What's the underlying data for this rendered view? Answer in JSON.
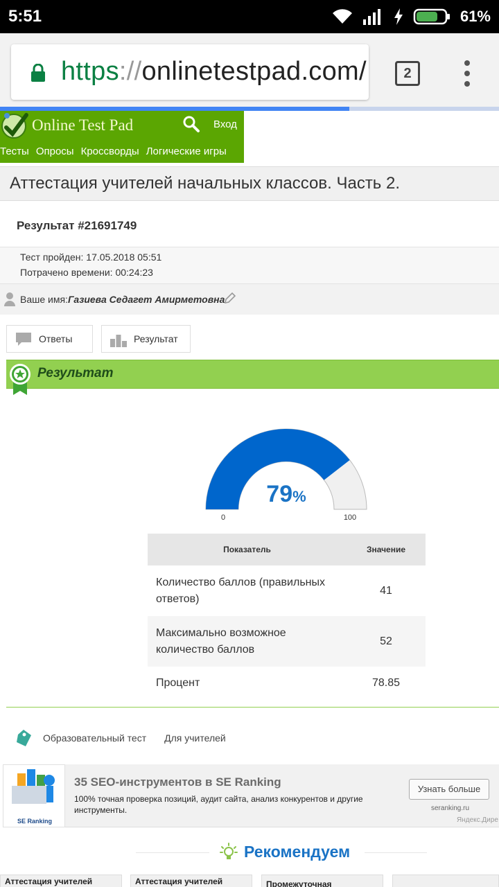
{
  "status_bar": {
    "time": "5:51",
    "battery_percent": "61%"
  },
  "browser": {
    "url": {
      "scheme": "https",
      "separator": "://",
      "host": "onlinetestpad.com/"
    },
    "tab_count": "2",
    "load_progress": 0.7
  },
  "site": {
    "name": "Online Test Pad",
    "login": "Вход",
    "nav": [
      "Тесты",
      "Опросы",
      "Кроссворды",
      "Логические игры"
    ]
  },
  "page": {
    "title": "Аттестация учителей начальных классов. Часть 2.",
    "result_id": "Результат #21691749"
  },
  "meta": {
    "passed_label": "Тест пройден:",
    "passed_value": "17.05.2018 05:51",
    "time_label": "Потрачено времени:",
    "time_value": "00:24:23"
  },
  "user": {
    "label": "Ваше имя:",
    "name": "Газиева Седагет Амирметовна"
  },
  "tabs": {
    "answers": "Ответы",
    "result": "Результат"
  },
  "result_section": {
    "title": "Результат"
  },
  "gauge": {
    "value": 79,
    "unit": "%",
    "min_label": "0",
    "max_label": "100",
    "color": "#0066cc"
  },
  "score_table": {
    "headers": [
      "Показатель",
      "Значение"
    ],
    "rows": [
      {
        "label": "Количество баллов (правильных ответов)",
        "value": "41"
      },
      {
        "label": "Максимально возможное количество баллов",
        "value": "52"
      },
      {
        "label": "Процент",
        "value": "78.85"
      }
    ]
  },
  "tags": [
    "Образовательный тест",
    "Для учителей"
  ],
  "ad": {
    "logo_text": "SE Ranking",
    "title": "35 SEO-инструментов в SE Ranking",
    "text": "100% точная проверка позиций, аудит сайта, анализ конкурентов и другие инструменты.",
    "button": "Узнать больше",
    "domain": "seranking.ru",
    "source": "Яндекс.Дирe"
  },
  "recommend": {
    "title": "Рекомендуем",
    "cards": [
      "Аттестация учителей",
      "Аттестация учителей",
      "Промежуточная"
    ]
  }
}
